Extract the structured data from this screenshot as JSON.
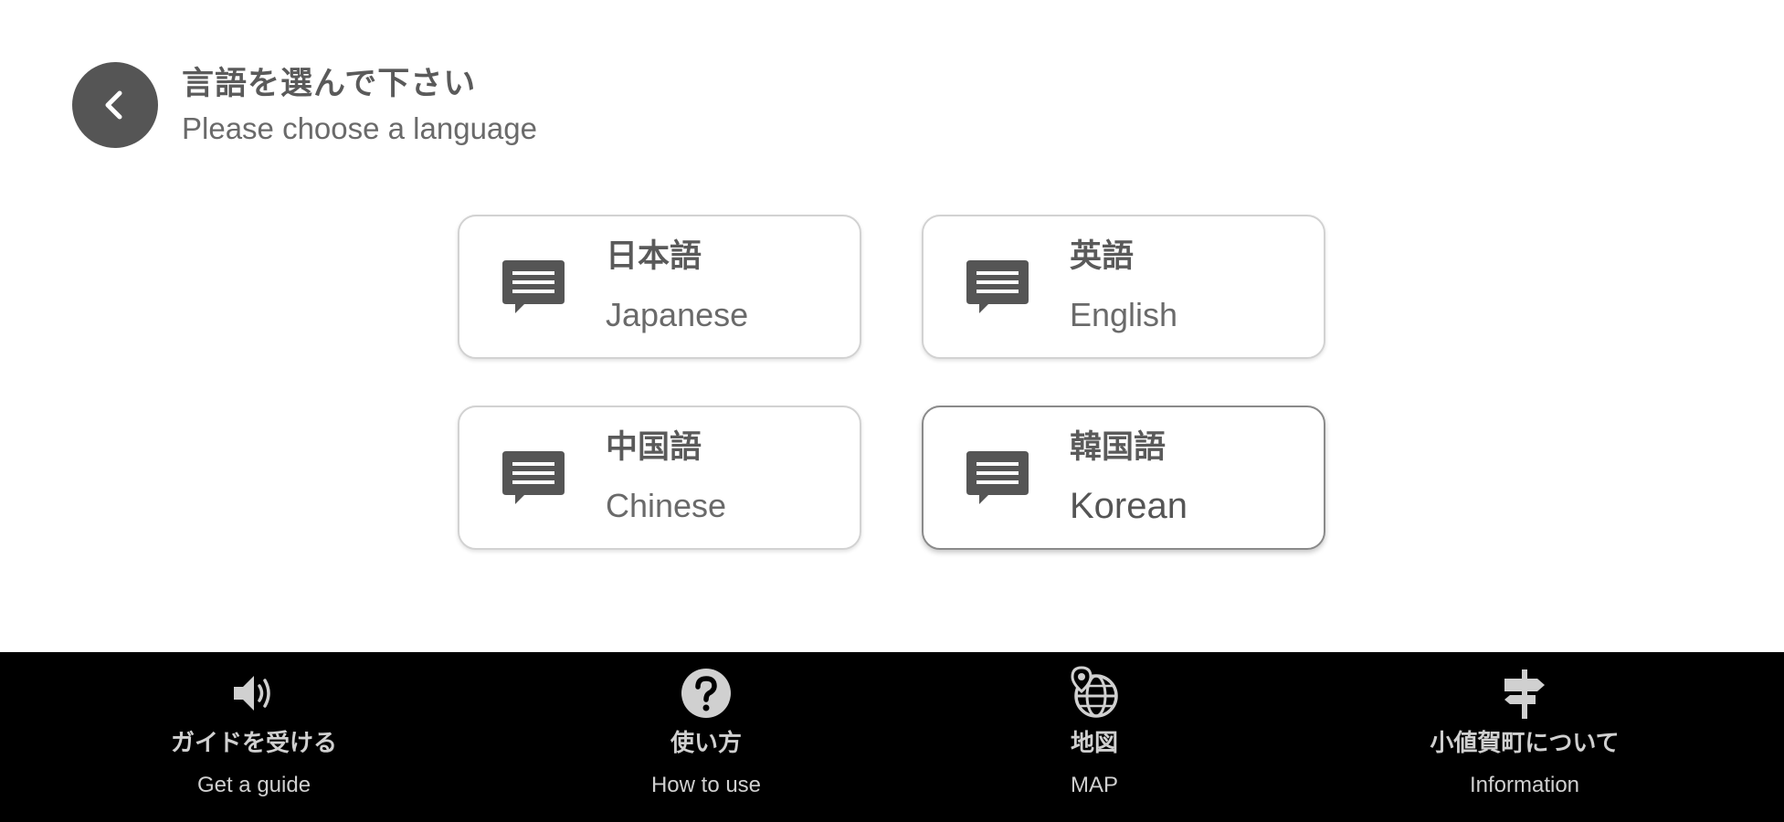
{
  "header": {
    "title": "言語を選んで下さい",
    "subtitle": "Please choose a language",
    "back_icon": "chevron-left-icon"
  },
  "languages": [
    {
      "label_jp": "日本語",
      "label_en": "Japanese",
      "icon": "chat-bubble-icon"
    },
    {
      "label_jp": "英語",
      "label_en": "English",
      "icon": "chat-bubble-icon"
    },
    {
      "label_jp": "中国語",
      "label_en": "Chinese",
      "icon": "chat-bubble-icon"
    },
    {
      "label_jp": "韓国語",
      "label_en": "Korean",
      "icon": "chat-bubble-icon"
    }
  ],
  "bottom_nav": [
    {
      "label_jp": "ガイドを受ける",
      "label_en": "Get a guide",
      "icon": "speaker-icon"
    },
    {
      "label_jp": "使い方",
      "label_en": "How to use",
      "icon": "help-icon"
    },
    {
      "label_jp": "地図",
      "label_en": "MAP",
      "icon": "globe-pin-icon"
    },
    {
      "label_jp": "小値賀町について",
      "label_en": "Information",
      "icon": "signpost-icon"
    }
  ],
  "colors": {
    "background": "#ffffff",
    "accent_dark": "#555555",
    "nav_background": "#000000",
    "nav_text": "#d0d0d0",
    "card_border": "#d2d2d2"
  }
}
